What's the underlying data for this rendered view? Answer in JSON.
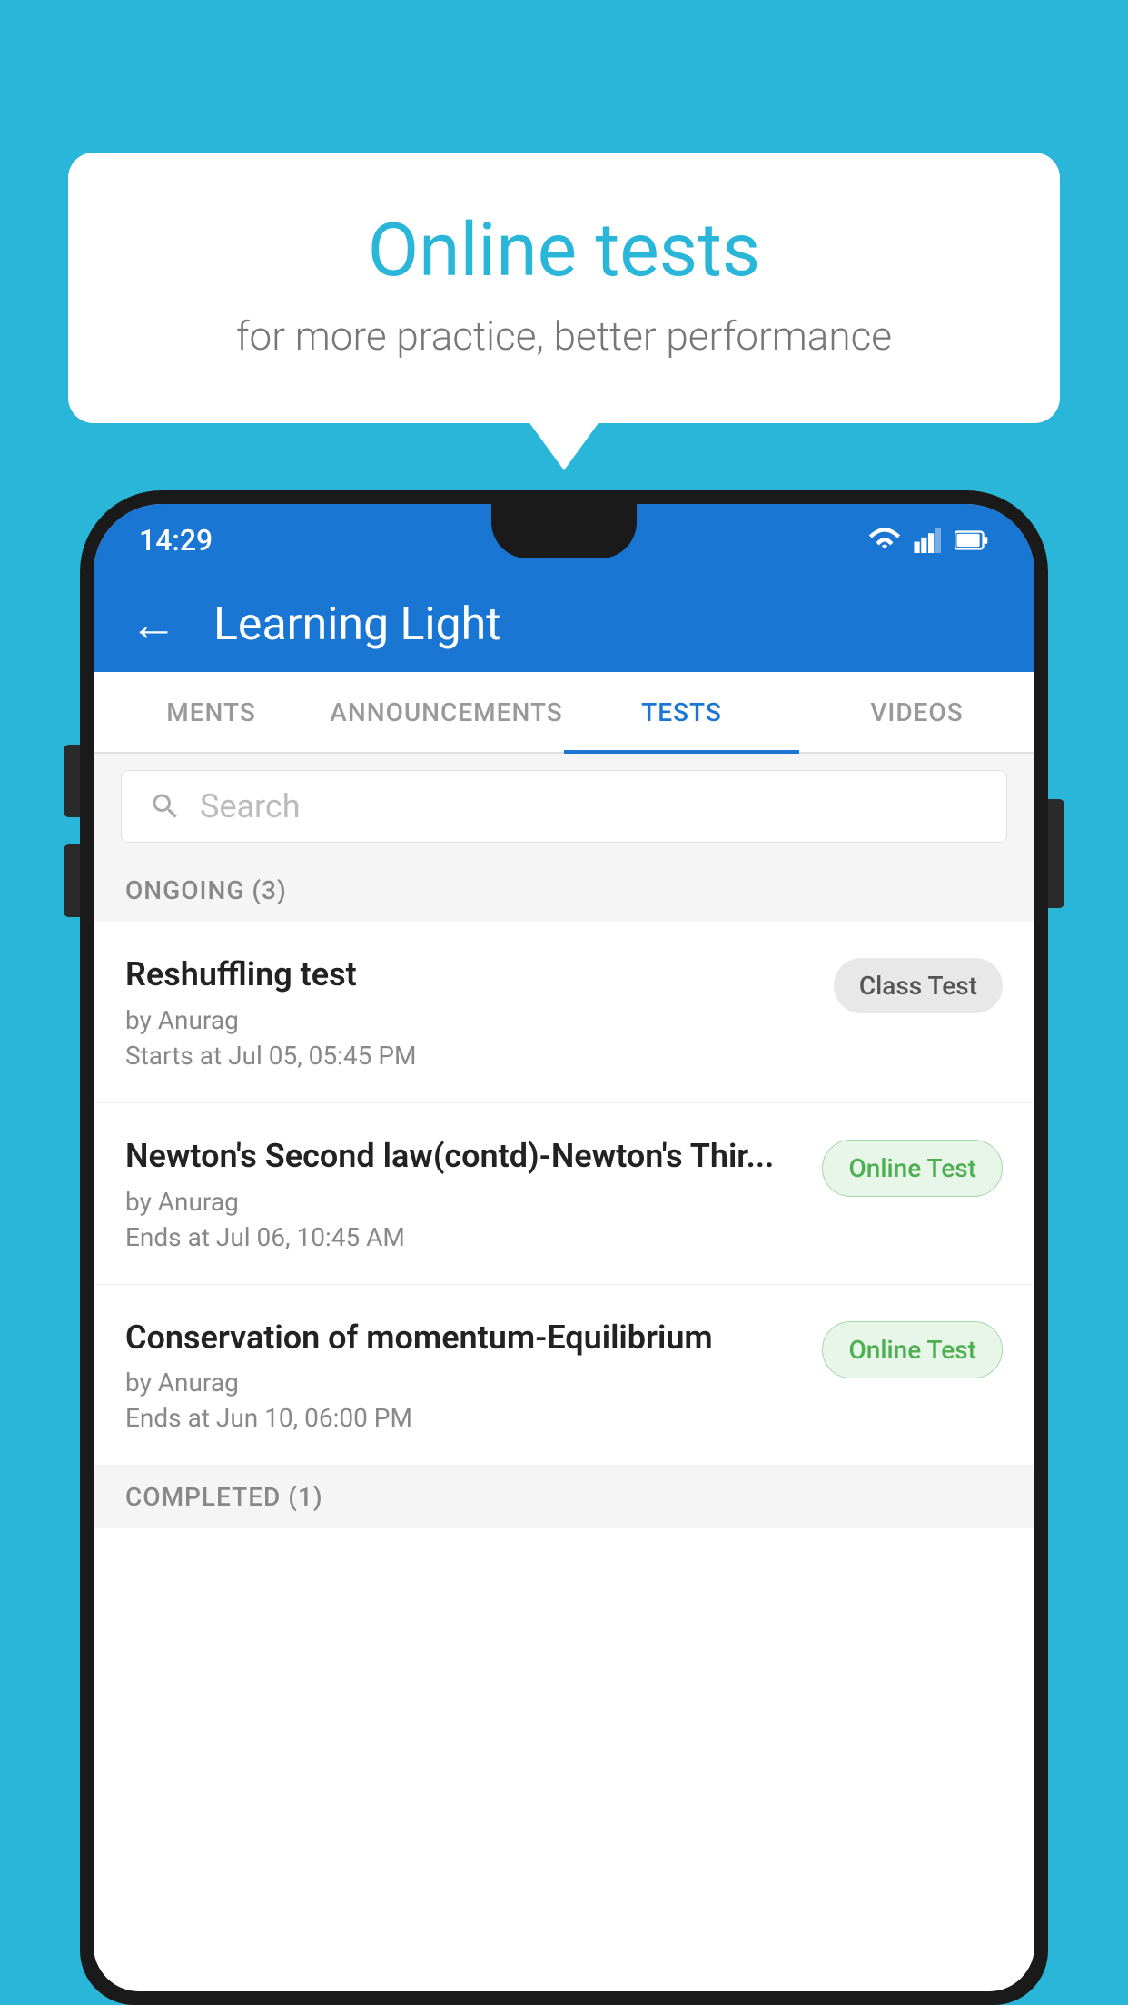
{
  "background_color": "#29b6d8",
  "speech_bubble": {
    "title": "Online tests",
    "subtitle": "for more practice, better performance"
  },
  "phone": {
    "status_bar": {
      "time": "14:29"
    },
    "app_bar": {
      "title": "Learning Light"
    },
    "tabs": [
      {
        "label": "MENTS",
        "active": false
      },
      {
        "label": "ANNOUNCEMENTS",
        "active": false
      },
      {
        "label": "TESTS",
        "active": true
      },
      {
        "label": "VIDEOS",
        "active": false
      }
    ],
    "search": {
      "placeholder": "Search"
    },
    "ongoing_section": {
      "header": "ONGOING (3)",
      "tests": [
        {
          "name": "Reshuffling test",
          "by": "by Anurag",
          "date": "Starts at  Jul 05, 05:45 PM",
          "badge": "Class Test",
          "badge_type": "class"
        },
        {
          "name": "Newton's Second law(contd)-Newton's Thir...",
          "by": "by Anurag",
          "date": "Ends at  Jul 06, 10:45 AM",
          "badge": "Online Test",
          "badge_type": "online"
        },
        {
          "name": "Conservation of momentum-Equilibrium",
          "by": "by Anurag",
          "date": "Ends at  Jun 10, 06:00 PM",
          "badge": "Online Test",
          "badge_type": "online"
        }
      ]
    },
    "completed_section": {
      "header": "COMPLETED (1)"
    }
  }
}
